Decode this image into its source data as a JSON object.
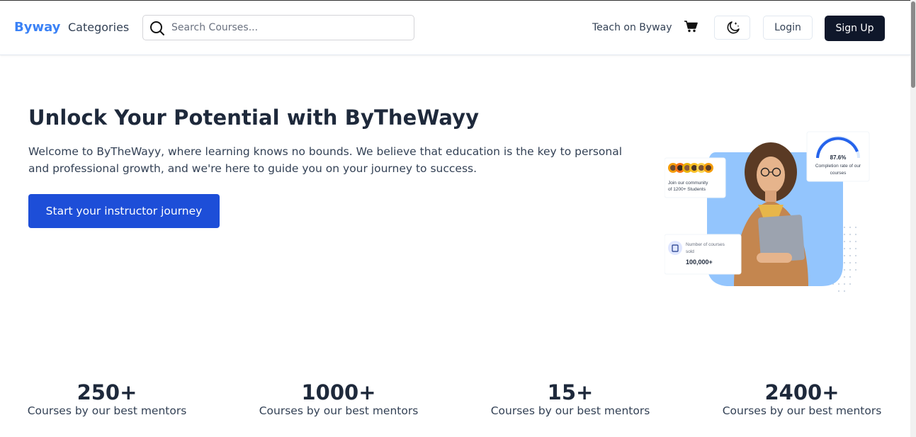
{
  "nav": {
    "logo": "Byway",
    "categories": "Categories",
    "search_placeholder": "Search Courses...",
    "teach": "Teach on Byway",
    "login": "Login",
    "signup": "Sign Up",
    "icons": [
      "search-icon",
      "cart-icon",
      "moon-icon"
    ]
  },
  "hero": {
    "title": "Unlock Your Potential with ByTheWayy",
    "text": "Welcome to ByTheWayy, where learning knows no bounds. We believe that education is the key to personal and professional growth, and we're here to guide you on your journey to success.",
    "cta": "Start your instructor journey",
    "image": {
      "community_text_1": "Join our community",
      "community_text_2": "of 1200+ Students",
      "completion_value": "87.6%",
      "completion_value_fraction": 0.876,
      "completion_text_1": "Completion rate of our",
      "completion_text_2": "courses",
      "courses_sold_text_1": "Number of courses",
      "courses_sold_text_2": "sold",
      "courses_sold_value": "100,000+"
    }
  },
  "stats": [
    {
      "number": "250+",
      "label": "Courses by our best mentors"
    },
    {
      "number": "1000+",
      "label": "Courses by our best mentors"
    },
    {
      "number": "15+",
      "label": "Courses by our best mentors"
    },
    {
      "number": "2400+",
      "label": "Courses by our best mentors"
    }
  ],
  "colors": {
    "brand": "#3b82f6",
    "cta": "#1d4ed8",
    "signup": "#0f172a",
    "illustration_bg": "#93c5fd"
  }
}
